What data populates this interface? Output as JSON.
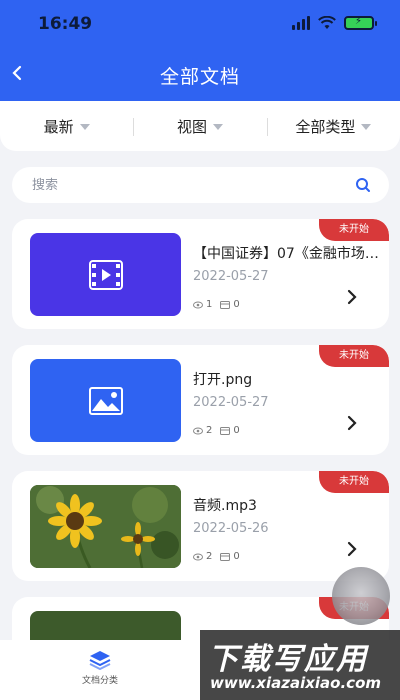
{
  "status_bar": {
    "time": "16:49"
  },
  "header": {
    "title": "全部文档"
  },
  "filters": [
    {
      "label": "最新"
    },
    {
      "label": "视图"
    },
    {
      "label": "全部类型"
    }
  ],
  "search": {
    "placeholder": "搜索"
  },
  "documents": [
    {
      "badge": "未开始",
      "name": "【中国证券】07《金融市场…",
      "date": "2022-05-27",
      "views": "1",
      "files": "0",
      "thumb": "video",
      "thumb_color": "#4a35e6"
    },
    {
      "badge": "未开始",
      "name": "打开.png",
      "date": "2022-05-27",
      "views": "2",
      "files": "0",
      "thumb": "image",
      "thumb_color": "#2f63f2"
    },
    {
      "badge": "未开始",
      "name": "音频.mp3",
      "date": "2022-05-26",
      "views": "2",
      "files": "0",
      "thumb": "photo-sunflower"
    },
    {
      "badge": "未开始"
    }
  ],
  "tabbar": {
    "items": [
      {
        "label": "文档分类",
        "icon": "layers-icon"
      }
    ]
  },
  "watermark": {
    "title": "下载写应用",
    "url": "www.xiazaixiao.com"
  },
  "colors": {
    "accent": "#2f63f2",
    "badge": "#d8393a"
  }
}
